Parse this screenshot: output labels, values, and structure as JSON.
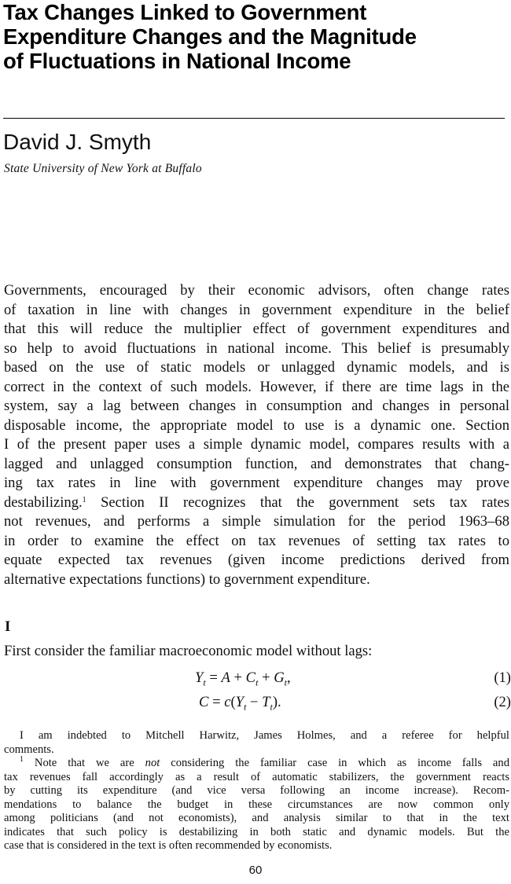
{
  "article": {
    "title_lines": [
      "Tax Changes Linked to Government",
      "Expenditure Changes and the Magnitude",
      "of Fluctuations in National Income"
    ],
    "author": "David J. Smyth",
    "affiliation": "State University of New York at Buffalo"
  },
  "body": {
    "intro_lines": [
      "Governments, encouraged by their economic advisors, often change rates",
      "of taxation in line with changes in government expenditure in the belief",
      "that this will reduce the multiplier effect of government expenditures and",
      "so help to avoid fluctuations in national income. This belief is presumably",
      "based on the use of static models or unlagged dynamic models, and is",
      "correct in the context of such models. However, if there are time lags in the",
      "system, say a lag between changes in consumption and changes in personal",
      "disposable income, the appropriate model to use is a dynamic one. Section",
      "I of the present paper uses a simple dynamic model, compares results with a",
      "lagged and unlagged consumption function, and demonstrates that chang-",
      "ing tax rates in line with government expenditure changes may prove",
      "destabilizing.",
      " Section II recognizes that the government sets tax rates",
      "not revenues, and performs a simple simulation for the period 1963–68",
      "in order to examine the effect on tax revenues of setting tax rates to",
      "equate expected tax revenues (given income predictions derived from",
      "alternative expectations functions) to government expenditure."
    ],
    "footnote_marker": "1",
    "section_heading": "I",
    "section_intro": "First consider the familiar macroeconomic model without lags:"
  },
  "equations": [
    {
      "label": "(1)"
    },
    {
      "label": "(2)"
    }
  ],
  "footnotes": {
    "acknowledgement_lines": [
      "I am indebted to Mitchell Harwitz, James Holmes, and a referee for helpful",
      "comments."
    ],
    "note1_marker": "1",
    "note1_lines": [
      " Note that we are ",
      "not",
      " considering the familiar case in which as income falls and",
      "tax revenues fall accordingly as a result of automatic stabilizers, the government reacts",
      "by cutting its expenditure (and vice versa following an income increase). Recom-",
      "mendations to balance the budget in these circumstances are now common only",
      "among politicians (and not economists), and analysis similar to that in the text",
      "indicates that such policy is destabilizing in both static and dynamic models. But the",
      "case that is considered in the text is often recommended by economists."
    ]
  },
  "page_number": "60"
}
